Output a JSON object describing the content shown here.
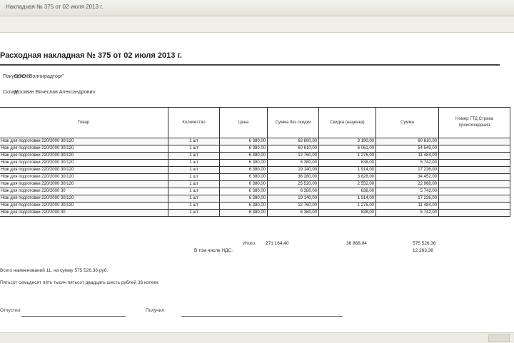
{
  "window": {
    "title": "Накладная № 375 от 02 июля 2013 г."
  },
  "doc": {
    "title": "Расходная накладная № 375 от 02 июля 2013 г.",
    "buyer_label": "Покупатель:",
    "buyer": "ООО \"Волгоградторг\"",
    "warehouse_label": "Склад:",
    "warehouse": "Москвин Вячеслав Александрович"
  },
  "table": {
    "headers": [
      "Товар",
      "Количество",
      "Цена",
      "Сумма без скидки",
      "Скидка (наценка)",
      "Сумма",
      "Номер ГТД Страна происхождения"
    ],
    "rows": [
      [
        "Нож для подготовки 220/2000 30/120",
        "1 шт",
        "6 380,00",
        "63 800,00",
        "3 190,00",
        "60 610,00",
        ""
      ],
      [
        "Нож для подготовки 220/2000 30/120",
        "1 шт",
        "6 380,00",
        "60 610,00",
        "6 061,00",
        "54 549,00",
        ""
      ],
      [
        "Нож для подготовки 220/2000 30/120",
        "1 шт",
        "6 380,00",
        "12 760,00",
        "1 276,00",
        "11 484,00",
        ""
      ],
      [
        "Нож для подготовки 220/2000 30/120",
        "1 шт",
        "6 380,00",
        "6 380,00",
        "638,00",
        "5 742,00",
        ""
      ],
      [
        "Нож для подготовки 220/2000 30/120",
        "1 шт",
        "6 380,00",
        "19 140,00",
        "1 914,00",
        "17 226,00",
        ""
      ],
      [
        "Нож для подготовки 220/2000 30/120",
        "1 шт",
        "6 380,00",
        "38 280,00",
        "3 828,00",
        "34 452,00",
        ""
      ],
      [
        "Нож для подготовки 220/2000 30/120",
        "1 шт",
        "6 380,00",
        "25 520,00",
        "2 552,00",
        "22 968,00",
        ""
      ],
      [
        "Нож для подготовки 220/2000 30",
        "1 шт",
        "6 380,00",
        "6 380,00",
        "638,00",
        "5 742,00",
        ""
      ],
      [
        "Нож для подготовки 220/2000 30/120",
        "1 шт",
        "6 380,00",
        "19 140,00",
        "1 914,00",
        "17 226,00",
        ""
      ],
      [
        "Нож для подготовки 220/2000 30/120",
        "1 шт",
        "6 380,00",
        "12 760,00",
        "1 276,00",
        "11 484,00",
        ""
      ],
      [
        "Нож для подготовки 220/2000 30",
        "1 шт",
        "6 380,00",
        "6 380,00",
        "638,00",
        "5 742,00",
        ""
      ]
    ]
  },
  "totals": {
    "total_label": "Итого:",
    "sum_wo_discount": "271 164,40",
    "discount": "36 868,04",
    "sum": "575 526,36",
    "vat_label": "В том числе НДС:",
    "vat": "12 263,38"
  },
  "footer": {
    "count_line": "Всего наименований 11, на сумму 575 526,36 руб.",
    "amount_words": "Пятьсот семьдесят пять тысяч пятьсот двадцать шесть рублей 36 копеек",
    "released_label": "Отпустил",
    "received_label": "Получил"
  }
}
